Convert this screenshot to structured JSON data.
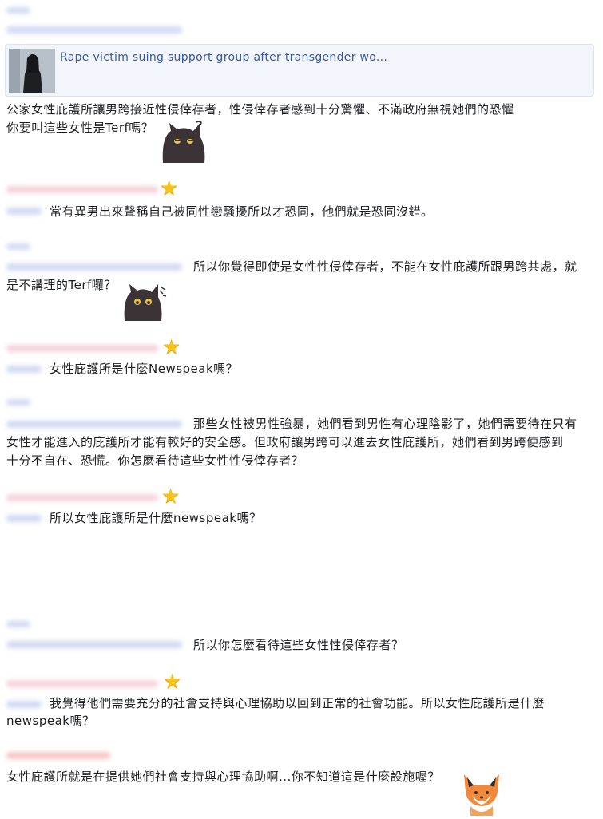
{
  "link_card": {
    "title": "Rape victim suing support group after transgender wo..."
  },
  "messages": {
    "m1": "公家女性庇護所讓男跨接近性侵倖存者，性侵倖存者感到十分驚懼、不滿政府無視她們的恐懼",
    "m1b": "你要叫這些女性是Terf嗎？",
    "m2": "常有異男出來聲稱自己被同性戀騷擾所以才恐同，他們就是恐同沒錯。",
    "m3a": "所以你覺得即使是女性性侵倖存者，不能在女性庇護所跟男跨共處，就",
    "m3b": "是不講理的Terf囉？",
    "m4": "女性庇護所是什麼Newspeak嗎？",
    "m5a": "那些女性被男性強暴，她們看到男性有心理陰影了，她們需要待在只有",
    "m5b": "女性才能進入的庇護所才能有較好的安全感。但政府讓男跨可以進去女性庇護所，她們看到男跨便感到",
    "m5c": "十分不自在、恐慌。你怎麼看待這些女性性侵倖存者？",
    "m6": "所以女性庇護所是什麼newspeak嗎？",
    "m7": "所以你怎麼看待這些女性性侵倖存者？",
    "m8a": "我覺得他們需要充分的社會支持與心理協助以回到正常的社會功能。所以女性庇護所是什麼",
    "m8b": "newspeak嗎？",
    "m9": "女性庇護所就是在提供她們社會支持與心理協助啊...你不知道這是什麼設施喔？"
  },
  "stickers": {
    "cat": "cat-question-sticker",
    "cat2": "cat-scratch-sticker",
    "fox": "fox-sticker",
    "star": "★",
    "question_mark": "?"
  },
  "colors": {
    "link": "#365899",
    "star": "#f7c21a",
    "meta_blue": "#4f63b8",
    "meta_pink": "#d9506e"
  }
}
